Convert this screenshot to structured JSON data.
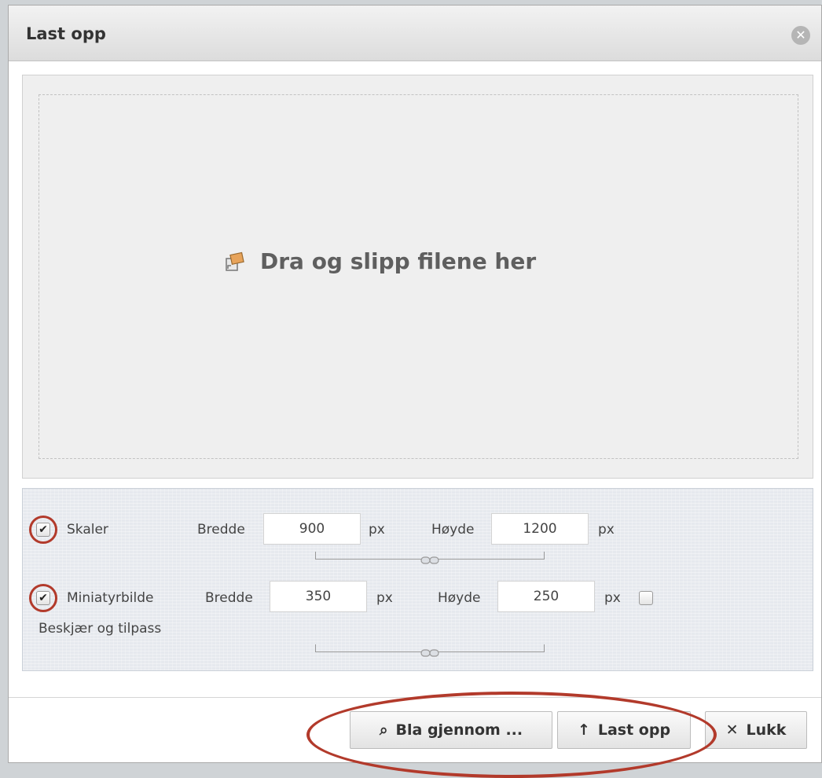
{
  "dialog": {
    "title": "Last opp",
    "close_icon": "close-icon"
  },
  "dropzone": {
    "text": "Dra og slipp filene her",
    "icon": "upload-image-icon"
  },
  "resize": {
    "checked": true,
    "label": "Skaler",
    "width_label": "Bredde",
    "width_value": "900",
    "width_unit": "px",
    "height_label": "Høyde",
    "height_value": "1200",
    "height_unit": "px"
  },
  "thumbnail": {
    "checked": true,
    "label": "Miniatyrbilde",
    "width_label": "Bredde",
    "width_value": "350",
    "width_unit": "px",
    "height_label": "Høyde",
    "height_value": "250",
    "height_unit": "px",
    "crop_checked": false,
    "crop_label": "Beskjær og tilpass"
  },
  "footer": {
    "browse_label": "Bla gjennom ...",
    "upload_label": "Last opp",
    "close_label": "Lukk"
  },
  "colors": {
    "highlight": "#b23a2b"
  }
}
